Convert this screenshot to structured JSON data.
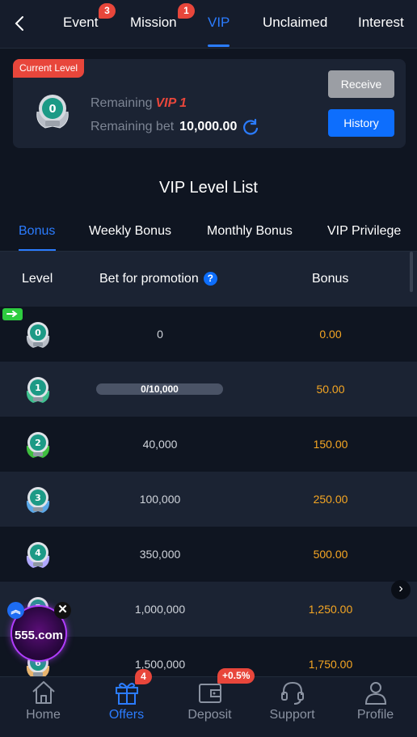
{
  "header": {
    "tabs": [
      {
        "label": "Event",
        "badge": "3"
      },
      {
        "label": "Mission",
        "badge": "1"
      },
      {
        "label": "VIP"
      },
      {
        "label": "Unclaimed"
      },
      {
        "label": "Interest"
      }
    ],
    "active_tab": "VIP"
  },
  "current_level": {
    "tag": "Current Level",
    "level": "0",
    "remaining_label": "Remaining",
    "remaining_value": "VIP 1",
    "remaining_bet_label": "Remaining bet",
    "remaining_bet_value": "10,000.00",
    "receive_label": "Receive",
    "history_label": "History"
  },
  "vip_list": {
    "title": "VIP Level List",
    "subtabs": [
      "Bonus",
      "Weekly Bonus",
      "Monthly Bonus",
      "VIP Privilege"
    ],
    "active_subtab": "Bonus",
    "columns": {
      "level": "Level",
      "bet": "Bet for promotion",
      "help": "?",
      "bonus": "Bonus"
    },
    "rows": [
      {
        "level": "0",
        "bet": "0",
        "bonus": "0.00"
      },
      {
        "level": "1",
        "bet": "0/10,000",
        "bonus": "50.00",
        "progress": 0
      },
      {
        "level": "2",
        "bet": "40,000",
        "bonus": "150.00"
      },
      {
        "level": "3",
        "bet": "100,000",
        "bonus": "250.00"
      },
      {
        "level": "4",
        "bet": "350,000",
        "bonus": "500.00"
      },
      {
        "level": "5",
        "bet": "1,000,000",
        "bonus": "1,250.00"
      },
      {
        "level": "6",
        "bet": "1,500,000",
        "bonus": "1,750.00"
      }
    ]
  },
  "floating_promo": {
    "text": "555.com",
    "close": "✕",
    "up": "︽"
  },
  "bottom_nav": {
    "items": [
      {
        "label": "Home"
      },
      {
        "label": "Offers",
        "badge": "4"
      },
      {
        "label": "Deposit",
        "badge": "+0.5%"
      },
      {
        "label": "Support"
      },
      {
        "label": "Profile"
      }
    ],
    "active": "Offers"
  },
  "colors": {
    "accent": "#2b7cff",
    "badge": "#e8463b",
    "bonus": "#f5a623",
    "background": "#0f1521"
  }
}
